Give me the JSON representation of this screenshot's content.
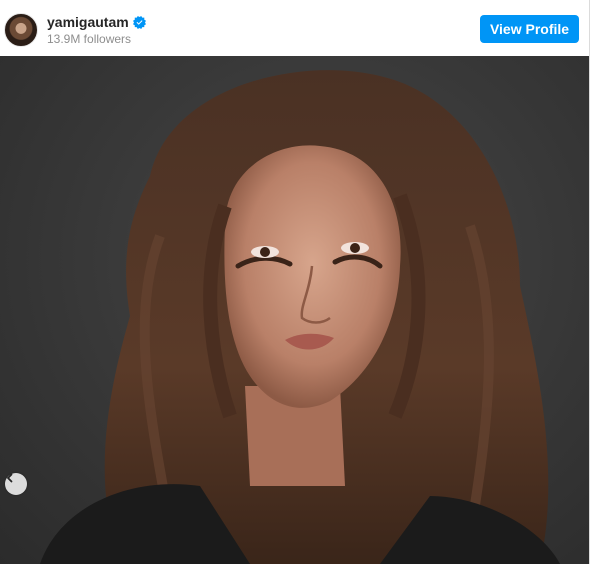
{
  "profile": {
    "username": "yamigautam",
    "verified": true,
    "followers": "13.9M followers",
    "view_profile_label": "View Profile"
  },
  "icons": {
    "verified": "verified-badge-icon",
    "prev": "chevron-left-icon"
  },
  "colors": {
    "accent": "#0095f6",
    "muted_text": "#8e8e8e",
    "background": "#ffffff"
  }
}
